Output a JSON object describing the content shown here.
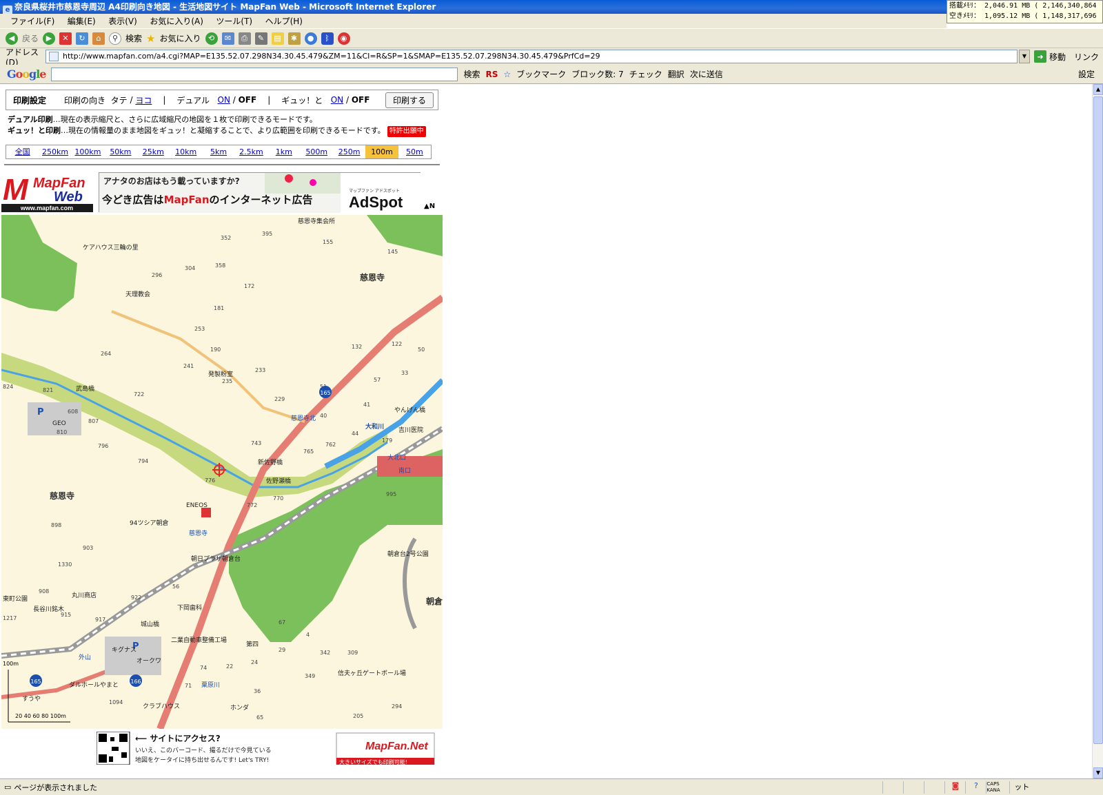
{
  "window": {
    "title": "奈良県桜井市慈恩寺周辺 A4印刷向き地図 - 生活地図サイト MapFan Web - Microsoft Internet Explorer"
  },
  "memory": {
    "line1": "搭載ﾒﾓﾘ： 2,046.91 MB ( 2,146,340,864",
    "line2": "空きﾒﾓﾘ： 1,095.12 MB ( 1,148,317,696"
  },
  "menu": [
    "ファイル(F)",
    "編集(E)",
    "表示(V)",
    "お気に入り(A)",
    "ツール(T)",
    "ヘルプ(H)"
  ],
  "toolbar": {
    "back": "戻る",
    "search": "検索",
    "favorites": "お気に入り"
  },
  "address": {
    "label": "アドレス(D)",
    "url": "http://www.mapfan.com/a4.cgi?MAP=E135.52.07.298N34.30.45.479&ZM=11&CI=R&SP=1&SMAP=E135.52.07.298N34.30.45.479&PrfCd=29",
    "go": "移動",
    "links": "リンク"
  },
  "googlebar": {
    "logo": "Google",
    "search": "検索",
    "bookmark": "ブックマーク",
    "blocked": "ブロック数: 7",
    "check": "チェック",
    "translate": "翻訳",
    "send": "次に送信",
    "settings": "設定"
  },
  "print": {
    "label": "印刷設定",
    "orientation": "印刷の向き",
    "tate": "タテ",
    "yoko": "ヨコ",
    "dual": "デュアル",
    "gyutto": "ギュッ！と",
    "on": "ON",
    "off": "OFF",
    "button": "印刷する"
  },
  "desc": {
    "dual_title": "デュアル印刷",
    "dual_text": "…現在の表示縮尺と、さらに広域縮尺の地図を１枚で印刷できるモードです。",
    "gyu_title": "ギュッ！と印刷",
    "gyu_text": "…現在の情報量のまま地図をギュッ！と凝縮することで、より広範囲を印刷できるモードです。",
    "tag": "特許出願中"
  },
  "scales": [
    "全国",
    "250km",
    "100km",
    "50km",
    "25km",
    "10km",
    "5km",
    "2.5km",
    "1km",
    "500m",
    "250m",
    "100m",
    "50m"
  ],
  "active_scale": "100m",
  "logo": {
    "line1": "MapFan",
    "line2": "Web",
    "url": "www.mapfan.com"
  },
  "ad": {
    "top": "アナタのお店はもう載っていますか?",
    "main1": "今どき広告は",
    "main2": "MapFan",
    "main3": "のインターネット広告",
    "brand_small": "マップファン アドスポット",
    "brand": "AdSpot"
  },
  "north": "▲N",
  "map": {
    "areas": [
      "慈恩寺",
      "慈恩寺",
      "朝倉"
    ],
    "labels": [
      "ケアハウス三輪の里",
      "天理教会",
      "慈恩寺集会所",
      "発製粉室",
      "武島橋",
      "慈恩寺北",
      "やんげん橋",
      "吉川医院",
      "大和川",
      "新佐野橋",
      "佐野瀬橋",
      "ENEOS",
      "94ツシア朝倉",
      "慈恩寺",
      "朝日プラザ朝倉台",
      "朝倉台2号公園",
      "丸川商店",
      "長谷川銘木",
      "下岡歯科",
      "城山橋",
      "二業自動車整備工場",
      "キグナス",
      "オークワ",
      "第四",
      "ダルホールやまと",
      "すうや",
      "ホンダ",
      "クラブハウス",
      "信夫ヶ丘ゲートボール場",
      "粟原川",
      "大北口",
      "南口",
      "東町公園",
      "外山",
      "GEO"
    ],
    "numbers": [
      "352",
      "395",
      "155",
      "145",
      "304",
      "358",
      "296",
      "172",
      "181",
      "253",
      "190",
      "264",
      "241",
      "235",
      "233",
      "132",
      "122",
      "50",
      "57",
      "33",
      "229",
      "41",
      "40",
      "51",
      "824",
      "821",
      "722",
      "608",
      "807",
      "810",
      "796",
      "794",
      "743",
      "765",
      "762",
      "179",
      "44",
      "776",
      "770",
      "772",
      "995",
      "898",
      "903",
      "1330",
      "908",
      "922",
      "915",
      "917",
      "1217",
      "56",
      "67",
      "4",
      "29",
      "342",
      "309",
      "349",
      "74",
      "22",
      "24",
      "71",
      "36",
      "65",
      "205",
      "294",
      "1094"
    ],
    "routes": [
      "165",
      "165",
      "166"
    ],
    "scalebar": {
      "top": "100m",
      "ticks": "20 40 60 80 100m"
    }
  },
  "footer": {
    "access": "サイトにアクセス?",
    "text1": "いいえ、このバーコード、撮るだけで今見ている",
    "text2": "地図をケータイに持ち出せるんです! Let's TRY!",
    "mfnet": "MapFan.Net",
    "mfnet_sub": "大きいサイズでも印刷可能!"
  },
  "status": {
    "text": "ページが表示されました",
    "caps": "CAPS",
    "kana": "KANA",
    "zone": "ット"
  },
  "colors": {
    "land": "#fbf6dd",
    "green": "#7cc05b",
    "river_band": "#c6d97e",
    "river": "#4aa2e6",
    "road_main": "#e57d73",
    "road_pref": "#f1c27a",
    "rail": "#666666"
  }
}
